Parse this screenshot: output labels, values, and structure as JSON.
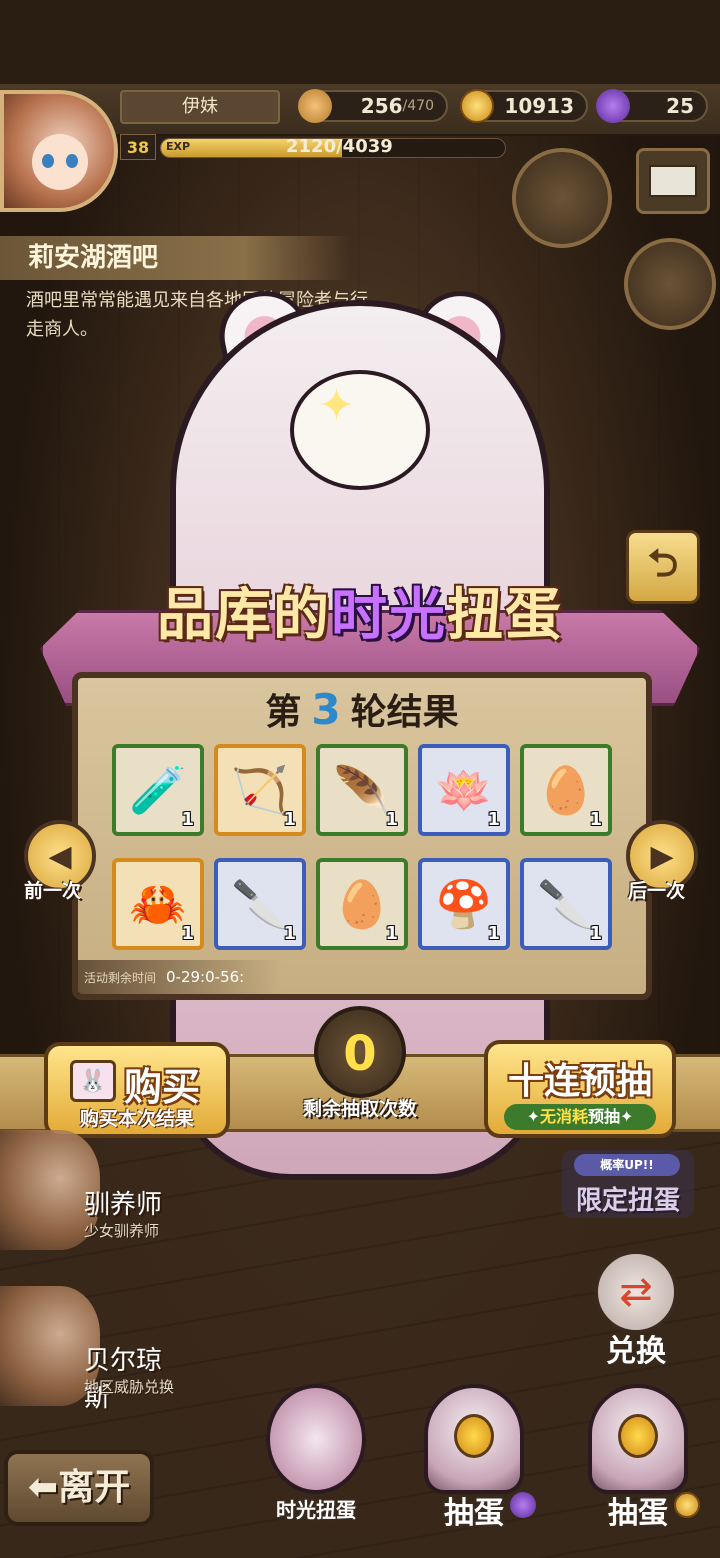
{
  "player": {
    "name": "伊妹",
    "level": "38",
    "exp_tag": "EXP",
    "exp_text": "2120/4039",
    "exp_fraction": 0.525
  },
  "resources": {
    "stamina_value": "256",
    "stamina_max": "/470",
    "gold": "10913",
    "gems": "25"
  },
  "location": {
    "title": "莉安湖酒吧",
    "description": "酒吧里常常能遇见来自各地区的冒险者与行走商人。"
  },
  "banner": {
    "title_a": "品库的",
    "title_b": "时光",
    "title_c": "扭蛋"
  },
  "results": {
    "round_prefix": "第",
    "round_number": "3",
    "round_suffix": "轮结果",
    "timer_label": "活动剩余时间",
    "timer_value": "0-29:0-56:",
    "items": [
      {
        "icon": "🧪",
        "count": "1",
        "quality": "green"
      },
      {
        "icon": "🏹",
        "count": "1",
        "quality": "gold"
      },
      {
        "icon": "🪶",
        "count": "1",
        "quality": "green"
      },
      {
        "icon": "🪷",
        "count": "1",
        "quality": "blue"
      },
      {
        "icon": "🥚",
        "count": "1",
        "quality": "green"
      },
      {
        "icon": "🦀",
        "count": "1",
        "quality": "gold"
      },
      {
        "icon": "🔪",
        "count": "1",
        "quality": "blue"
      },
      {
        "icon": "🥚",
        "count": "1",
        "quality": "green"
      },
      {
        "icon": "🍄",
        "count": "1",
        "quality": "blue"
      },
      {
        "icon": "🔪",
        "count": "1",
        "quality": "blue"
      }
    ]
  },
  "nav": {
    "prev_label": "前一次",
    "next_label": "后一次"
  },
  "actions": {
    "buy_main": "购买",
    "buy_sub": "购买本次结果",
    "draws_remaining": "0",
    "draws_label": "剩余抽取次数",
    "ten_main": "十连预抽",
    "ten_sub_a": "无消耗",
    "ten_sub_b": "预抽"
  },
  "npcs": [
    {
      "name": "驯养师",
      "subtitle": "少女驯养师"
    },
    {
      "name": "贝尔琼斯",
      "subtitle": "地区威胁兑换"
    }
  ],
  "side": {
    "limited_tag": "概率UP!!",
    "limited_label": "限定扭蛋",
    "exchange_label": "兑换"
  },
  "bottom": {
    "leave": "⬅离开",
    "time_gacha": "时光扭蛋",
    "draw_gem": "抽蛋",
    "draw_gold": "抽蛋"
  },
  "colors": {
    "accent_gold": "#e2aa37",
    "quality_green": "#3b7b2a",
    "quality_blue": "#3d5dbb",
    "quality_gold": "#d48a1d",
    "title_purple": "#c870ff"
  }
}
